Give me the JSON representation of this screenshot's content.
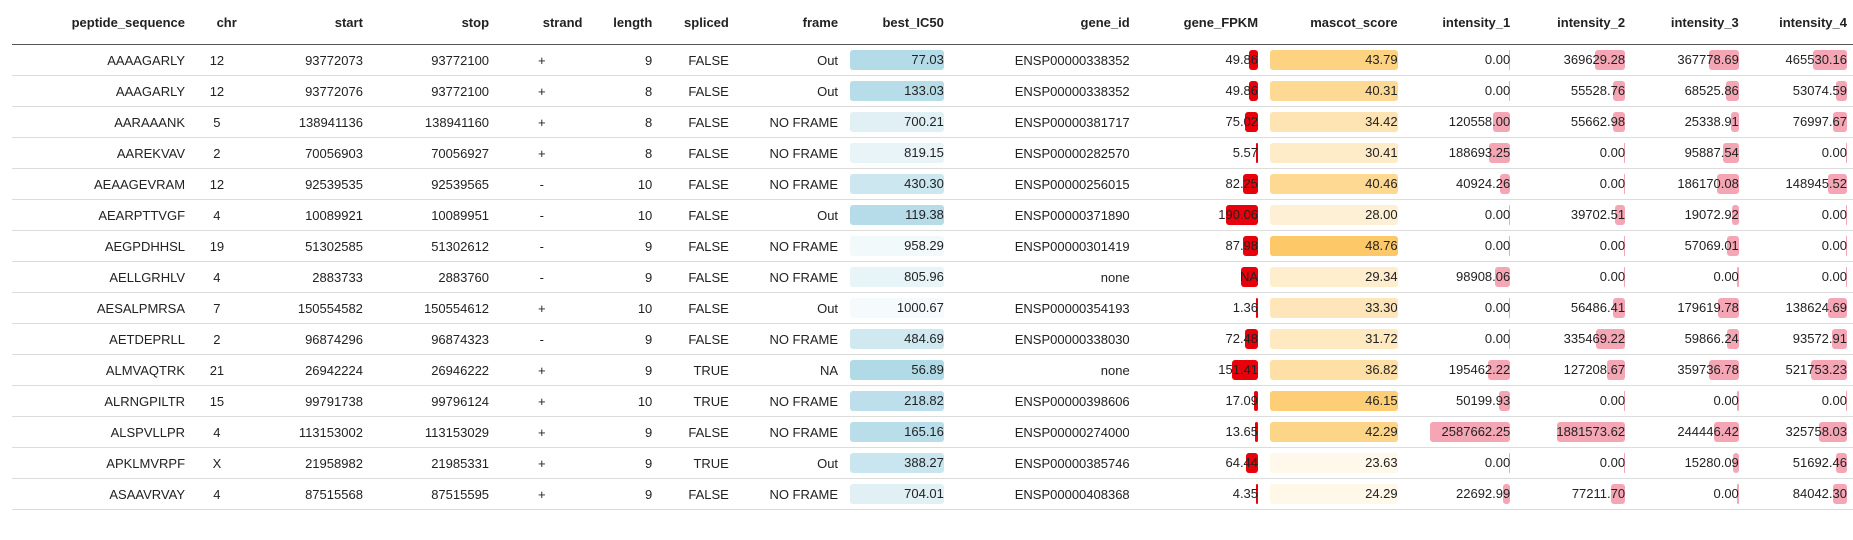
{
  "columns": [
    "peptide_sequence",
    "chr",
    "start",
    "stop",
    "strand",
    "length",
    "spliced",
    "frame",
    "best_IC50",
    "gene_id",
    "gene_FPKM",
    "mascot_score",
    "intensity_1",
    "intensity_2",
    "intensity_3",
    "intensity_4"
  ],
  "colors": {
    "ic50_bar": "#add8e6",
    "fpkm_bar": "#e8000b",
    "mascot_bar": "#fdc968",
    "intensity_bar": "#f4a6b5"
  },
  "rows": [
    {
      "peptide_sequence": "AAAAGARLY",
      "chr": "12",
      "start": "93772073",
      "stop": "93772100",
      "strand": "+",
      "length": "9",
      "spliced": "FALSE",
      "frame": "Out",
      "best_IC50": "77.03",
      "gene_id": "ENSP00000338352",
      "gene_FPKM": "49.86",
      "mascot_score": "43.79",
      "intensity_1": "0.00",
      "intensity_2": "369629.28",
      "intensity_3": "367778.69",
      "intensity_4": "465530.16"
    },
    {
      "peptide_sequence": "AAAGARLY",
      "chr": "12",
      "start": "93772076",
      "stop": "93772100",
      "strand": "+",
      "length": "8",
      "spliced": "FALSE",
      "frame": "Out",
      "best_IC50": "133.03",
      "gene_id": "ENSP00000338352",
      "gene_FPKM": "49.86",
      "mascot_score": "40.31",
      "intensity_1": "0.00",
      "intensity_2": "55528.76",
      "intensity_3": "68525.86",
      "intensity_4": "53074.59"
    },
    {
      "peptide_sequence": "AARAAANK",
      "chr": "5",
      "start": "138941136",
      "stop": "138941160",
      "strand": "+",
      "length": "8",
      "spliced": "FALSE",
      "frame": "NO FRAME",
      "best_IC50": "700.21",
      "gene_id": "ENSP00000381717",
      "gene_FPKM": "75.02",
      "mascot_score": "34.42",
      "intensity_1": "120558.00",
      "intensity_2": "55662.98",
      "intensity_3": "25338.91",
      "intensity_4": "76997.67"
    },
    {
      "peptide_sequence": "AAREKVAV",
      "chr": "2",
      "start": "70056903",
      "stop": "70056927",
      "strand": "+",
      "length": "8",
      "spliced": "FALSE",
      "frame": "NO FRAME",
      "best_IC50": "819.15",
      "gene_id": "ENSP00000282570",
      "gene_FPKM": "5.57",
      "mascot_score": "30.41",
      "intensity_1": "188693.25",
      "intensity_2": "0.00",
      "intensity_3": "95887.54",
      "intensity_4": "0.00"
    },
    {
      "peptide_sequence": "AEAAGEVRAM",
      "chr": "12",
      "start": "92539535",
      "stop": "92539565",
      "strand": "-",
      "length": "10",
      "spliced": "FALSE",
      "frame": "NO FRAME",
      "best_IC50": "430.30",
      "gene_id": "ENSP00000256015",
      "gene_FPKM": "82.25",
      "mascot_score": "40.46",
      "intensity_1": "40924.26",
      "intensity_2": "0.00",
      "intensity_3": "186170.08",
      "intensity_4": "148945.52"
    },
    {
      "peptide_sequence": "AEARPTTVGF",
      "chr": "4",
      "start": "10089921",
      "stop": "10089951",
      "strand": "-",
      "length": "10",
      "spliced": "FALSE",
      "frame": "Out",
      "best_IC50": "119.38",
      "gene_id": "ENSP00000371890",
      "gene_FPKM": "190.06",
      "mascot_score": "28.00",
      "intensity_1": "0.00",
      "intensity_2": "39702.51",
      "intensity_3": "19072.92",
      "intensity_4": "0.00"
    },
    {
      "peptide_sequence": "AEGPDHHSL",
      "chr": "19",
      "start": "51302585",
      "stop": "51302612",
      "strand": "-",
      "length": "9",
      "spliced": "FALSE",
      "frame": "NO FRAME",
      "best_IC50": "958.29",
      "gene_id": "ENSP00000301419",
      "gene_FPKM": "87.98",
      "mascot_score": "48.76",
      "intensity_1": "0.00",
      "intensity_2": "0.00",
      "intensity_3": "57069.01",
      "intensity_4": "0.00"
    },
    {
      "peptide_sequence": "AELLGRHLV",
      "chr": "4",
      "start": "2883733",
      "stop": "2883760",
      "strand": "-",
      "length": "9",
      "spliced": "FALSE",
      "frame": "NO FRAME",
      "best_IC50": "805.96",
      "gene_id": "none",
      "gene_FPKM": "NA",
      "mascot_score": "29.34",
      "intensity_1": "98908.06",
      "intensity_2": "0.00",
      "intensity_3": "0.00",
      "intensity_4": "0.00"
    },
    {
      "peptide_sequence": "AESALPMRSA",
      "chr": "7",
      "start": "150554582",
      "stop": "150554612",
      "strand": "+",
      "length": "10",
      "spliced": "FALSE",
      "frame": "Out",
      "best_IC50": "1000.67",
      "gene_id": "ENSP00000354193",
      "gene_FPKM": "1.36",
      "mascot_score": "33.30",
      "intensity_1": "0.00",
      "intensity_2": "56486.41",
      "intensity_3": "179619.78",
      "intensity_4": "138624.69"
    },
    {
      "peptide_sequence": "AETDEPRLL",
      "chr": "2",
      "start": "96874296",
      "stop": "96874323",
      "strand": "-",
      "length": "9",
      "spliced": "FALSE",
      "frame": "NO FRAME",
      "best_IC50": "484.69",
      "gene_id": "ENSP00000338030",
      "gene_FPKM": "72.48",
      "mascot_score": "31.72",
      "intensity_1": "0.00",
      "intensity_2": "335469.22",
      "intensity_3": "59866.24",
      "intensity_4": "93572.91"
    },
    {
      "peptide_sequence": "ALMVAQTRK",
      "chr": "21",
      "start": "26942224",
      "stop": "26946222",
      "strand": "+",
      "length": "9",
      "spliced": "TRUE",
      "frame": "NA",
      "best_IC50": "56.89",
      "gene_id": "none",
      "gene_FPKM": "151.41",
      "mascot_score": "36.82",
      "intensity_1": "195462.22",
      "intensity_2": "127208.67",
      "intensity_3": "359736.78",
      "intensity_4": "521753.23"
    },
    {
      "peptide_sequence": "ALRNGPILTR",
      "chr": "15",
      "start": "99791738",
      "stop": "99796124",
      "strand": "+",
      "length": "10",
      "spliced": "TRUE",
      "frame": "NO FRAME",
      "best_IC50": "218.82",
      "gene_id": "ENSP00000398606",
      "gene_FPKM": "17.09",
      "mascot_score": "46.15",
      "intensity_1": "50199.93",
      "intensity_2": "0.00",
      "intensity_3": "0.00",
      "intensity_4": "0.00"
    },
    {
      "peptide_sequence": "ALSPVLLPR",
      "chr": "4",
      "start": "113153002",
      "stop": "113153029",
      "strand": "+",
      "length": "9",
      "spliced": "FALSE",
      "frame": "NO FRAME",
      "best_IC50": "165.16",
      "gene_id": "ENSP00000274000",
      "gene_FPKM": "13.65",
      "mascot_score": "42.29",
      "intensity_1": "2587662.25",
      "intensity_2": "1881573.62",
      "intensity_3": "244446.42",
      "intensity_4": "325758.03"
    },
    {
      "peptide_sequence": "APKLMVRPF",
      "chr": "X",
      "start": "21958982",
      "stop": "21985331",
      "strand": "+",
      "length": "9",
      "spliced": "TRUE",
      "frame": "Out",
      "best_IC50": "388.27",
      "gene_id": "ENSP00000385746",
      "gene_FPKM": "64.44",
      "mascot_score": "23.63",
      "intensity_1": "0.00",
      "intensity_2": "0.00",
      "intensity_3": "15280.09",
      "intensity_4": "51692.46"
    },
    {
      "peptide_sequence": "ASAAVRVAY",
      "chr": "4",
      "start": "87515568",
      "stop": "87515595",
      "strand": "+",
      "length": "9",
      "spliced": "FALSE",
      "frame": "NO FRAME",
      "best_IC50": "704.01",
      "gene_id": "ENSP00000408368",
      "gene_FPKM": "4.35",
      "mascot_score": "24.29",
      "intensity_1": "22692.99",
      "intensity_2": "77211.70",
      "intensity_3": "0.00",
      "intensity_4": "84042.30"
    },
    {
      "peptide_sequence": "",
      "chr": "",
      "start": "",
      "stop": "",
      "strand": "",
      "length": "",
      "spliced": "",
      "frame": "",
      "best_IC50": "",
      "gene_id": "",
      "gene_FPKM": "",
      "mascot_score": "",
      "intensity_1": "",
      "intensity_2": "",
      "intensity_3": "",
      "intensity_4": ""
    }
  ]
}
